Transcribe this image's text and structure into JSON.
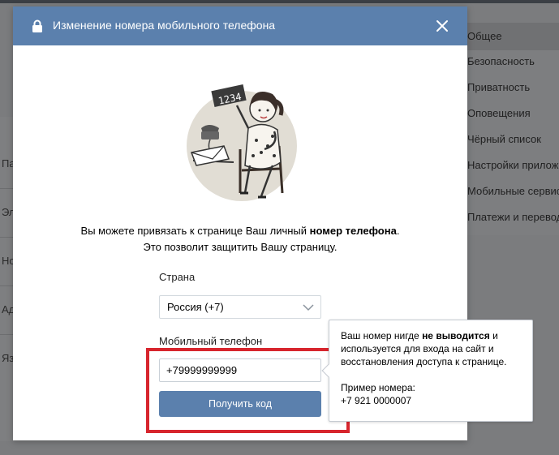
{
  "background": {
    "left_items": [
      "Па",
      "Эл",
      "Но",
      "Ад",
      "Яз"
    ],
    "right_menu": [
      "Общее",
      "Безопасность",
      "Приватность",
      "Оповещения",
      "Чёрный список",
      "Настройки приложений",
      "Мобильные сервисы",
      "Платежи и переводы"
    ]
  },
  "modal": {
    "title": "Изменение номера мобильного телефона",
    "description": {
      "line1_prefix": "Вы можете привязать к странице Ваш личный ",
      "line1_bold": "номер телефона",
      "line1_suffix": ".",
      "line2": "Это позволит защитить Вашу страницу."
    },
    "country_label": "Страна",
    "country_value": "Россия (+7)",
    "phone_label": "Мобильный телефон",
    "phone_value": "+79999999999",
    "submit_label": "Получить код",
    "illustration_card_text": "1234"
  },
  "tooltip": {
    "prefix": "Ваш номер нигде ",
    "bold": "не выводится",
    "suffix": " и используется для входа на сайт и восстановления доступа к странице.",
    "example_label": "Пример номера:",
    "example_value": "+7 921 0000007"
  },
  "colors": {
    "header": "#5b80ad",
    "button": "#5b80ad",
    "highlight": "#d7252d"
  }
}
